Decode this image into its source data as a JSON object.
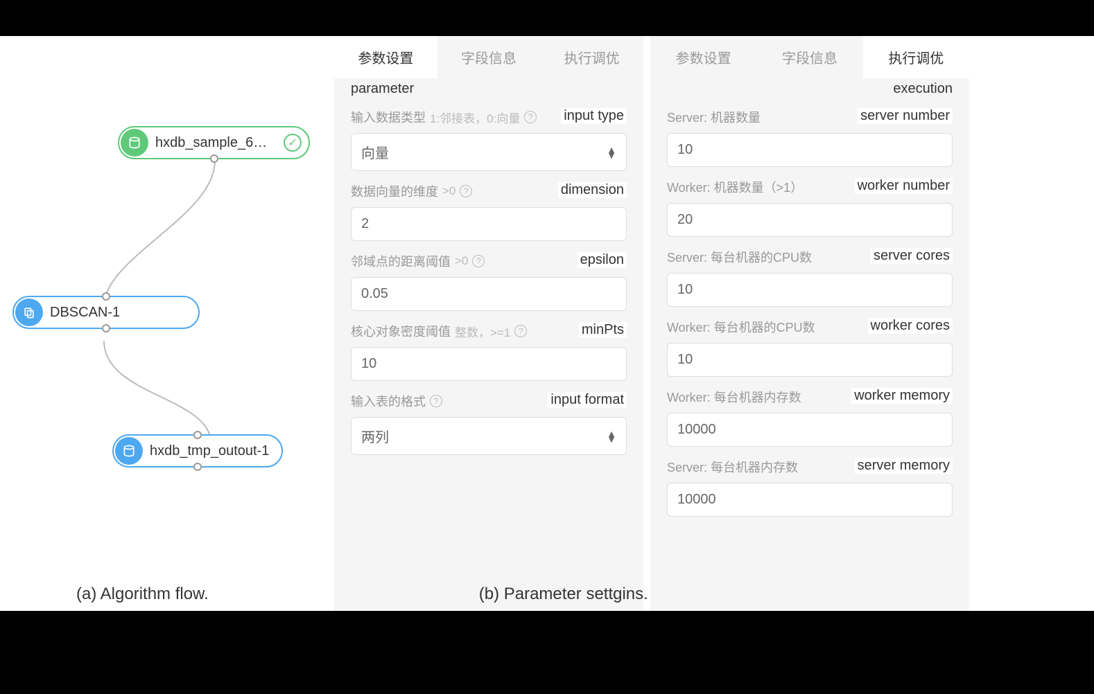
{
  "flow": {
    "nodes": [
      {
        "id": "source",
        "label": "hxdb_sample_6…",
        "status": "success"
      },
      {
        "id": "dbscan",
        "label": "DBSCAN-1"
      },
      {
        "id": "output",
        "label": "hxdb_tmp_outout-1"
      }
    ]
  },
  "captions": {
    "a": "(a) Algorithm flow.",
    "b": "(b) Parameter settgins."
  },
  "paramPanel": {
    "tabs": {
      "parameter": "参数设置",
      "fields": "字段信息",
      "execution": "执行调优"
    },
    "annotation_parameter": "parameter",
    "fields": {
      "inputType": {
        "label": "输入数据类型",
        "hint": "1:邻接表，0:向量",
        "value": "向量",
        "annotation": "input type"
      },
      "dimension": {
        "label": "数据向量的维度",
        "hint": ">0",
        "value": "2",
        "annotation": "dimension"
      },
      "epsilon": {
        "label": "邻域点的距离阈值",
        "hint": ">0",
        "value": "0.05",
        "annotation": "epsilon"
      },
      "minPts": {
        "label": "核心对象密度阈值",
        "hint": "整数，>=1",
        "value": "10",
        "annotation": "minPts"
      },
      "inputFormat": {
        "label": "输入表的格式",
        "value": "两列",
        "annotation": "input format"
      }
    }
  },
  "execPanel": {
    "tabs": {
      "parameter": "参数设置",
      "fields": "字段信息",
      "execution": "执行调优"
    },
    "annotation_execution": "execution",
    "fields": {
      "serverNumber": {
        "label": "Server: 机器数量",
        "value": "10",
        "annotation": "server number"
      },
      "workerNumber": {
        "label": "Worker: 机器数量（>1）",
        "value": "20",
        "annotation": "worker number"
      },
      "serverCores": {
        "label": "Server: 每台机器的CPU数",
        "value": "10",
        "annotation": "server cores"
      },
      "workerCores": {
        "label": "Worker: 每台机器的CPU数",
        "value": "10",
        "annotation": "worker cores"
      },
      "workerMemory": {
        "label": "Worker: 每台机器内存数",
        "value": "10000",
        "annotation": "worker memory"
      },
      "serverMemory": {
        "label": "Server: 每台机器内存数",
        "value": "10000",
        "annotation": "server memory"
      }
    }
  }
}
